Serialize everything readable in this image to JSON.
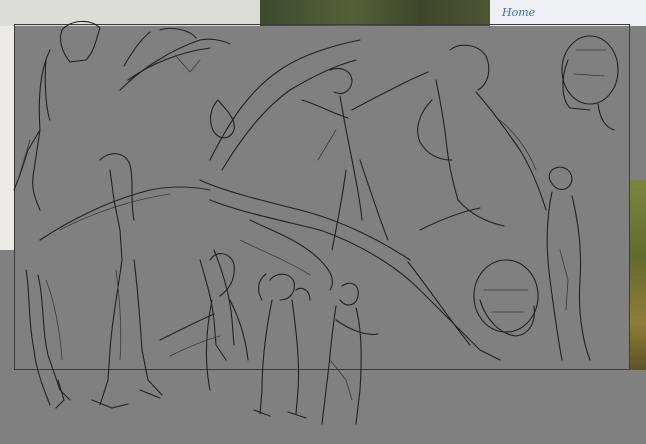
{
  "reference_panels": {
    "right_label": "Home"
  },
  "sketch": {
    "subject": "gesture-figure-studies"
  }
}
